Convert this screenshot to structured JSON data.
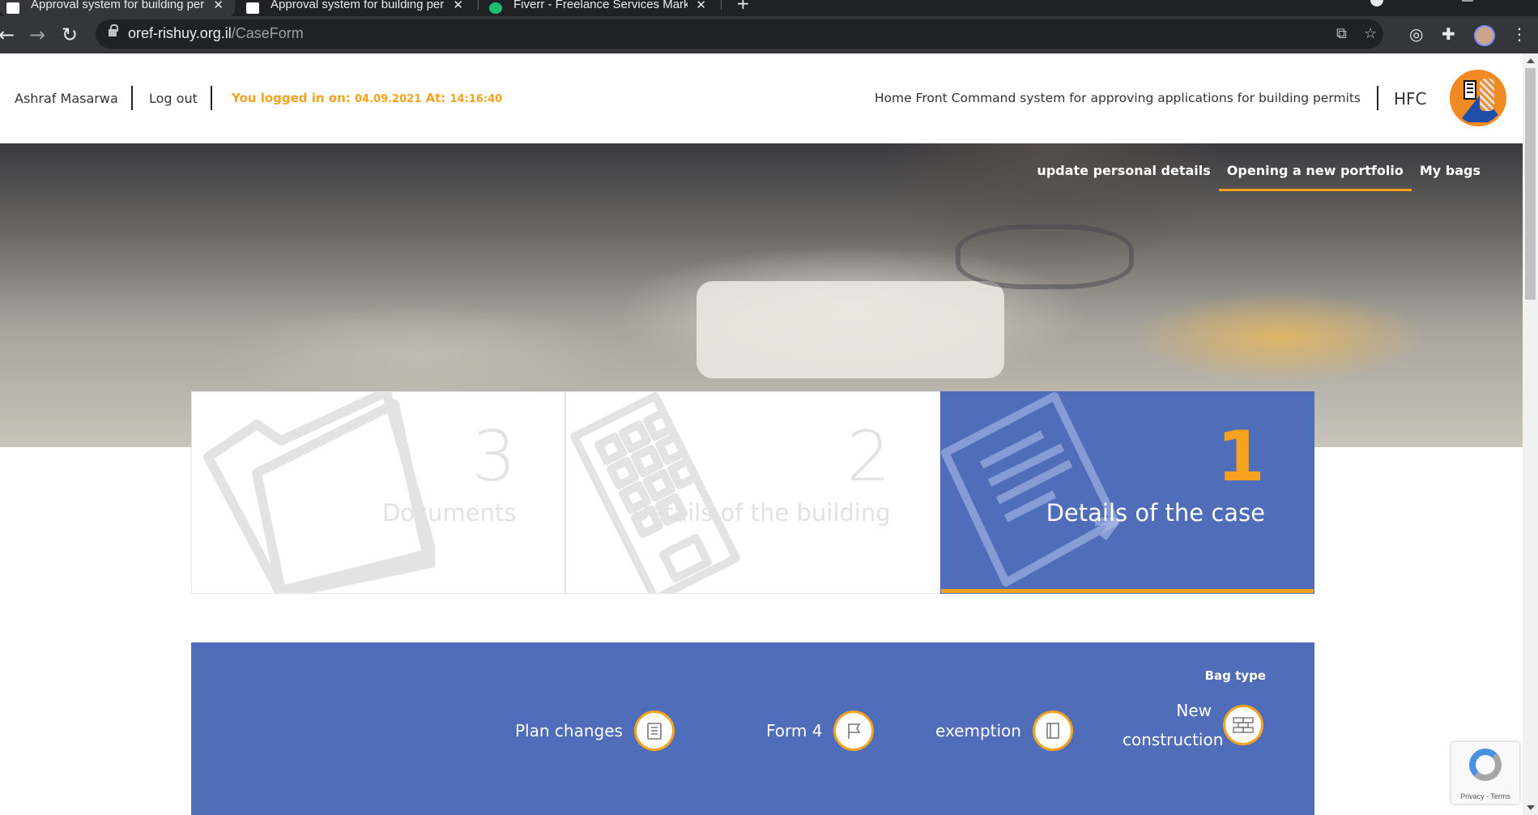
{
  "browser": {
    "tabs": [
      {
        "title": "Approval system for building per",
        "active": true
      },
      {
        "title": "Approval system for building per",
        "active": false
      },
      {
        "title": "Fiverr - Freelance Services Marke",
        "active": false
      }
    ],
    "url_host": "oref-rishuy.org.il",
    "url_path": "/CaseForm"
  },
  "header": {
    "user_name": "Ashraf Masarwa",
    "logout_label": "Log out",
    "logged_prefix": "You logged in on: ",
    "logged_date": "04.09.2021",
    "logged_at": " At: ",
    "logged_time": "14:16:40",
    "system_title": "Home Front Command system for approving applications for building permits",
    "abbr": "HFC"
  },
  "nav": {
    "update_details": "update personal details",
    "new_portfolio": "Opening a new portfolio",
    "my_bags": "My bags"
  },
  "steps": [
    {
      "number": "3",
      "label": "Documents",
      "active": false
    },
    {
      "number": "2",
      "label": "Details of the building",
      "active": false
    },
    {
      "number": "1",
      "label": "Details of the case",
      "active": true
    }
  ],
  "bag": {
    "title": "Bag type",
    "options": [
      {
        "label": "Plan changes",
        "icon": "clipboard-icon"
      },
      {
        "label": "Form 4",
        "icon": "flag-icon"
      },
      {
        "label": "exemption",
        "icon": "document-icon"
      },
      {
        "label": "New construction",
        "icon": "bricks-icon"
      }
    ]
  },
  "recaptcha": {
    "text": "Privacy - Terms"
  },
  "colors": {
    "accent": "#f7a21e",
    "primary": "#4f6db8"
  }
}
